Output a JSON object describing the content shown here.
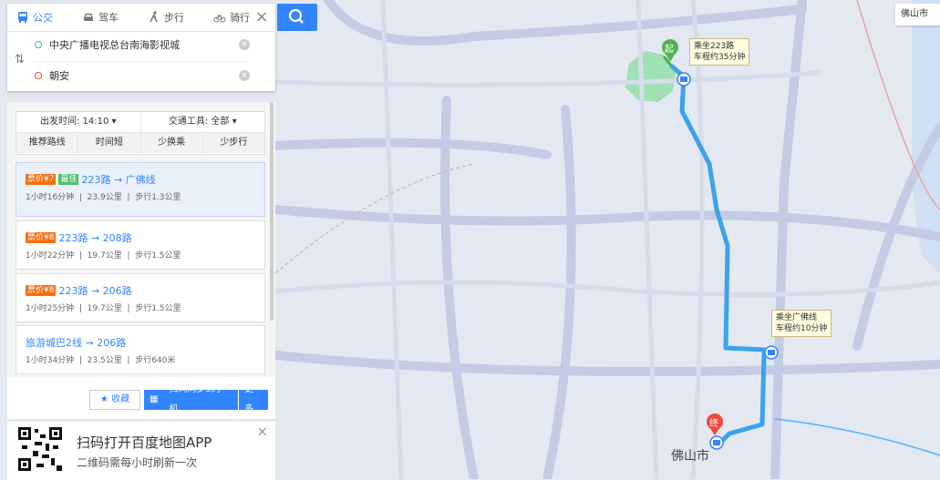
{
  "colors": {
    "accent": "#3385ff",
    "route_line": "#3aa3ec",
    "price_tag": "#f66f0e",
    "fastest_tag": "#4cbf6c"
  },
  "modes": [
    {
      "label": "公交",
      "icon": "bus-icon"
    },
    {
      "label": "驾车",
      "icon": "car-icon"
    },
    {
      "label": "步行",
      "icon": "walk-icon"
    },
    {
      "label": "骑行",
      "icon": "bike-icon"
    }
  ],
  "search": {
    "origin": "中央广播电视总台南海影视城",
    "destination": "朝安"
  },
  "filters": {
    "depart": "出发时间: 14:10",
    "tool": "交通工具: 全部",
    "sorts": [
      "推荐路线",
      "时间短",
      "少换乘",
      "少步行"
    ]
  },
  "routes": [
    {
      "price": "票价¥7",
      "badge": "最佳",
      "name": "223路 → 广佛线",
      "duration": "1小时16分钟",
      "distance": "23.9公里",
      "walk": "步行1.3公里"
    },
    {
      "price": "票价¥8",
      "badge": "",
      "name": "223路 → 208路",
      "duration": "1小时22分钟",
      "distance": "19.7公里",
      "walk": "步行1.5公里"
    },
    {
      "price": "票价¥8",
      "badge": "",
      "name": "223路 → 206路",
      "duration": "1小时25分钟",
      "distance": "19.7公里",
      "walk": "步行1.5公里"
    },
    {
      "price": "",
      "badge": "",
      "name": "旅游城巴2线 → 206路",
      "duration": "1小时34分钟",
      "distance": "23.5公里",
      "walk": "步行640米"
    }
  ],
  "actions": {
    "favorite": "收藏",
    "scan": "扫码同步到手机",
    "more": "更多"
  },
  "ad": {
    "title": "扫码打开百度地图APP",
    "subtitle": "二维码需每小时刷新一次"
  },
  "map": {
    "start_marker": "起",
    "end_marker": "终",
    "label1": [
      "乘坐223路",
      "车程约35分钟"
    ],
    "label2": [
      "乘坐广佛线",
      "车程约10分钟"
    ],
    "city": "佛山市",
    "corner": "佛山市"
  }
}
